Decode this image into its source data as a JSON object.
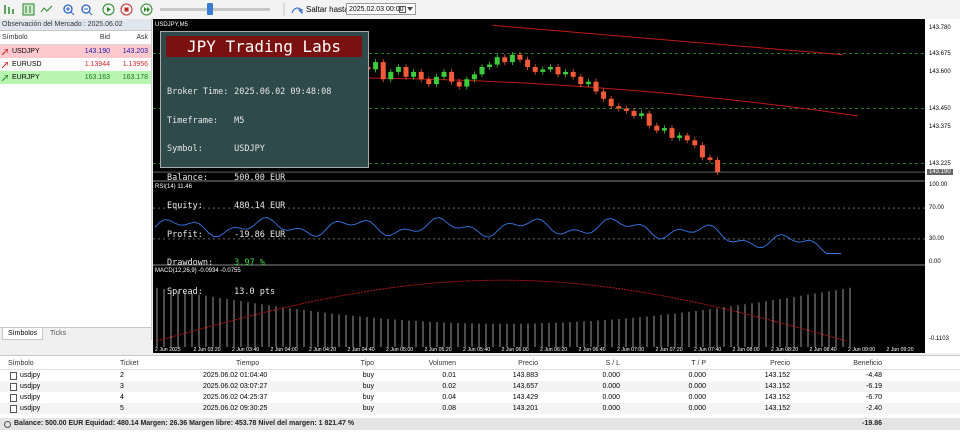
{
  "toolbar": {
    "goto_label": "Saltar hasta",
    "date_value": "2025.02.03 00:00"
  },
  "market_watch": {
    "title": "Observación del Mercado : 2025.06.02",
    "columns": {
      "symbol": "Símbolo",
      "bid": "Bid",
      "ask": "Ask"
    },
    "rows": [
      {
        "symbol": "USDJPY",
        "bid": "143.190",
        "ask": "143.203"
      },
      {
        "symbol": "EURUSD",
        "bid": "1.13944",
        "ask": "1.13956"
      },
      {
        "symbol": "EURJPY",
        "bid": "163.163",
        "ask": "163.178"
      }
    ],
    "tabs": [
      "Símbolos",
      "Ticks"
    ]
  },
  "chart": {
    "header": "USDJPY,M5",
    "rsi_label": "RSI(14) 11.46",
    "macd_label": "MACD(12,26,9) -0.0934 -0.0755",
    "price_labels": [
      "143.780",
      "143.675",
      "143.600",
      "143.450",
      "143.375",
      "143.225",
      "143.190"
    ],
    "rsi_labels": [
      "100.00",
      "70.00",
      "30.00",
      "0.00"
    ],
    "macd_labels": [
      "-0.1103"
    ],
    "time_labels": [
      "2 Jun 2025",
      "2 Jun 03:20",
      "2 Jun 03:40",
      "2 Jun 04:00",
      "2 Jun 04:20",
      "2 Jun 04:40",
      "2 Jun 05:00",
      "2 Jun 05:20",
      "2 Jun 05:40",
      "2 Jun 06:00",
      "2 Jun 06:20",
      "2 Jun 06:40",
      "2 Jun 07:00",
      "2 Jun 07:20",
      "2 Jun 07:40",
      "2 Jun 08:00",
      "2 Jun 08:20",
      "2 Jun 08:40",
      "2 Jun 09:00",
      "2 Jun 09:20"
    ],
    "candle_closes": [
      143.61,
      143.64,
      143.57,
      143.6,
      143.62,
      143.58,
      143.6,
      143.57,
      143.55,
      143.58,
      143.6,
      143.56,
      143.54,
      143.57,
      143.59,
      143.62,
      143.63,
      143.66,
      143.64,
      143.67,
      143.65,
      143.62,
      143.6,
      143.61,
      143.62,
      143.59,
      143.6,
      143.58,
      143.55,
      143.56,
      143.52,
      143.49,
      143.46,
      143.45,
      143.44,
      143.42,
      143.43,
      143.38,
      143.36,
      143.37,
      143.33,
      143.34,
      143.32,
      143.3,
      143.25,
      143.24,
      143.19
    ]
  },
  "info_panel": {
    "title": "JPY Trading Labs",
    "rows": [
      {
        "key": "Broker Time:",
        "value": "2025.06.02 09:48:08",
        "color": "#e8e8e8"
      },
      {
        "key": "Timeframe:",
        "value": "M5",
        "color": "#e8e8e8"
      },
      {
        "key": "Symbol:",
        "value": "USDJPY",
        "color": "#e8e8e8"
      },
      {
        "key": "Balance:",
        "value": "500.00 EUR",
        "color": "#e8e8e8"
      },
      {
        "key": "Equity:",
        "value": "480.14 EUR",
        "color": "#e8e8e8"
      },
      {
        "key": "Profit:",
        "value": "-19.86 EUR",
        "color": "#e8e8e8"
      },
      {
        "key": "Drawdown:",
        "value": "3.97 %",
        "color": "#3ddc3d"
      },
      {
        "key": "Spread:",
        "value": "13.0 pts",
        "color": "#e8e8e8"
      }
    ]
  },
  "trades": {
    "columns": [
      "Símbolo",
      "Ticket",
      "Tiempo",
      "Tipo",
      "Volumen",
      "Precio",
      "S / L",
      "T / P",
      "Precio",
      "Beneficio"
    ],
    "rows": [
      {
        "symbol": "usdjpy",
        "ticket": "2",
        "time": "2025.06.02 01:04:40",
        "type": "buy",
        "volume": "0.01",
        "price": "143.883",
        "sl": "0.000",
        "tp": "0.000",
        "current": "143.152",
        "profit": "-4.48"
      },
      {
        "symbol": "usdjpy",
        "ticket": "3",
        "time": "2025.06.02 03:07:27",
        "type": "buy",
        "volume": "0.02",
        "price": "143.657",
        "sl": "0.000",
        "tp": "0.000",
        "current": "143.152",
        "profit": "-6.19"
      },
      {
        "symbol": "usdjpy",
        "ticket": "4",
        "time": "2025.06.02 04:25:37",
        "type": "buy",
        "volume": "0.04",
        "price": "143.429",
        "sl": "0.000",
        "tp": "0.000",
        "current": "143.152",
        "profit": "-6.70"
      },
      {
        "symbol": "usdjpy",
        "ticket": "5",
        "time": "2025.06.02 09:30:25",
        "type": "buy",
        "volume": "0.08",
        "price": "143.201",
        "sl": "0.000",
        "tp": "0.000",
        "current": "143.152",
        "profit": "-2.40"
      }
    ],
    "status": "Balance: 500.00 EUR  Equidad: 480.14  Margen: 26.36  Margen libre: 453.78  Nivel del margen: 1 821.47 %",
    "total_profit": "-19.86"
  }
}
